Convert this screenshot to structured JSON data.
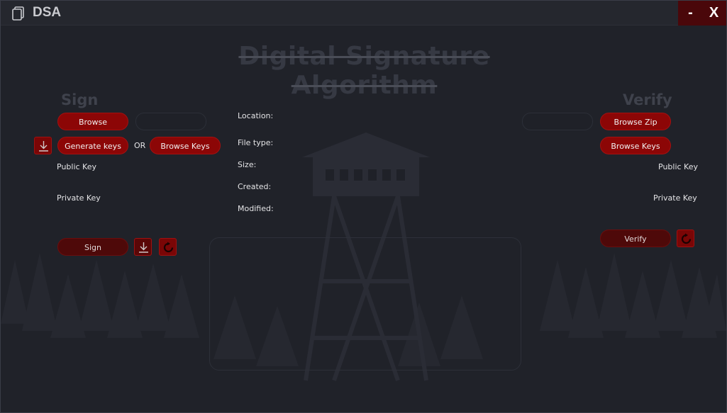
{
  "window": {
    "title": "DSA",
    "minimize_label": "-",
    "close_label": "X"
  },
  "main": {
    "title": "Digital Signature Algorithm"
  },
  "sign": {
    "heading": "Sign",
    "browse_label": "Browse",
    "generate_keys_label": "Generate keys",
    "or_label": "OR",
    "browse_keys_label": "Browse Keys",
    "public_key_label": "Public Key",
    "private_key_label": "Private Key",
    "sign_label": "Sign"
  },
  "file_info": {
    "location_label": "Location:",
    "file_type_label": "File type:",
    "size_label": "Size:",
    "created_label": "Created:",
    "modified_label": "Modified:"
  },
  "verify": {
    "heading": "Verify",
    "browse_zip_label": "Browse Zip",
    "browse_keys_label": "Browse Keys",
    "public_key_label": "Public Key",
    "private_key_label": "Private Key",
    "verify_label": "Verify"
  },
  "colors": {
    "accent": "#8c0606",
    "accent_dark": "#4e0909",
    "background": "#202229"
  },
  "icons": [
    "app-icon",
    "download-icon",
    "refresh-icon"
  ]
}
